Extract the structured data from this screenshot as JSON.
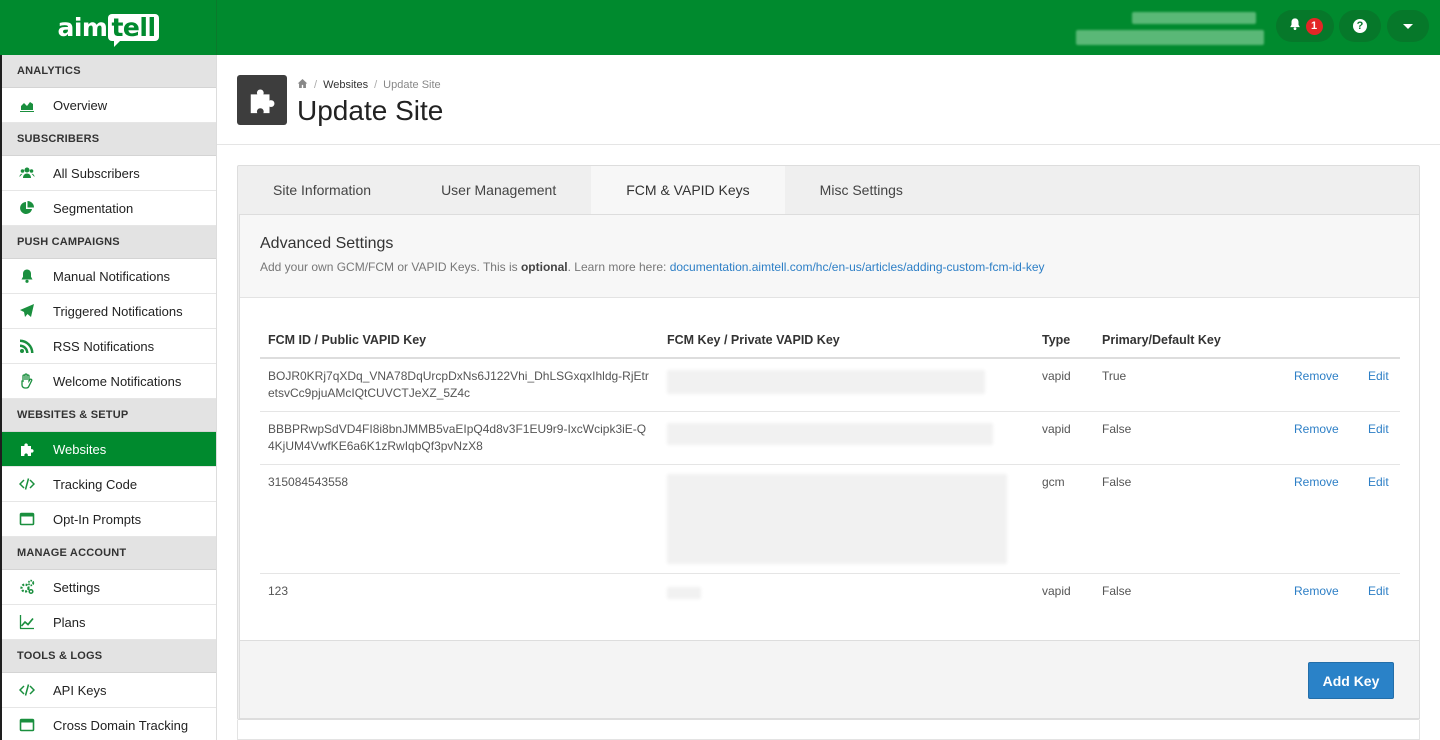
{
  "brand": {
    "logo_left": "aim",
    "logo_right": "tell",
    "accent": "#008a2e"
  },
  "topbar": {
    "notification_count": "1",
    "icons": [
      "bell-icon",
      "help-icon",
      "caret-down-icon"
    ]
  },
  "sidebar": {
    "sections": [
      {
        "title": "ANALYTICS",
        "items": [
          {
            "label": "Overview",
            "icon": "area-chart-icon"
          }
        ]
      },
      {
        "title": "SUBSCRIBERS",
        "items": [
          {
            "label": "All Subscribers",
            "icon": "users-icon"
          },
          {
            "label": "Segmentation",
            "icon": "pie-chart-icon"
          }
        ]
      },
      {
        "title": "PUSH CAMPAIGNS",
        "items": [
          {
            "label": "Manual Notifications",
            "icon": "bell-icon"
          },
          {
            "label": "Triggered Notifications",
            "icon": "paper-plane-icon"
          },
          {
            "label": "RSS Notifications",
            "icon": "rss-icon"
          },
          {
            "label": "Welcome Notifications",
            "icon": "hand-wave-icon"
          }
        ]
      },
      {
        "title": "WEBSITES & SETUP",
        "items": [
          {
            "label": "Websites",
            "icon": "puzzle-icon",
            "active": true
          },
          {
            "label": "Tracking Code",
            "icon": "code-icon"
          },
          {
            "label": "Opt-In Prompts",
            "icon": "window-icon"
          }
        ]
      },
      {
        "title": "MANAGE ACCOUNT",
        "items": [
          {
            "label": "Settings",
            "icon": "cogs-icon"
          },
          {
            "label": "Plans",
            "icon": "line-chart-icon"
          }
        ]
      },
      {
        "title": "TOOLS & LOGS",
        "items": [
          {
            "label": "API Keys",
            "icon": "code-icon"
          },
          {
            "label": "Cross Domain Tracking",
            "icon": "window-icon"
          }
        ]
      }
    ]
  },
  "header": {
    "breadcrumb": {
      "home_icon": "home-icon",
      "parent": "Websites",
      "sep": "/",
      "current": "Update Site"
    },
    "title": "Update Site",
    "page_icon": "puzzle-icon"
  },
  "tabs": [
    {
      "label": "Site Information",
      "active": false
    },
    {
      "label": "User Management",
      "active": false
    },
    {
      "label": "FCM & VAPID Keys",
      "active": true
    },
    {
      "label": "Misc Settings",
      "active": false
    }
  ],
  "advanced": {
    "title": "Advanced Settings",
    "desc_before": "Add your own GCM/FCM or VAPID Keys. This is ",
    "desc_bold": "optional",
    "desc_after": ". Learn more here: ",
    "link": "documentation.aimtell.com/hc/en-us/articles/adding-custom-fcm-id-key"
  },
  "table": {
    "headers": [
      "FCM ID / Public VAPID Key",
      "FCM Key / Private VAPID Key",
      "Type",
      "Primary/Default Key",
      "",
      ""
    ],
    "rows": [
      {
        "public_key": "BOJR0KRj7qXDq_VNA78DqUrcpDxNs6J122Vhi_DhLSGxqxIhldg-RjEtretsvCc9pjuAMcIQtCUVCTJeXZ_5Z4c",
        "type": "vapid",
        "primary": "True",
        "remove": "Remove",
        "edit": "Edit"
      },
      {
        "public_key": "BBBPRwpSdVD4FI8i8bnJMMB5vaEIpQ4d8v3F1EU9r9-IxcWcipk3iE-Q4KjUM4VwfKE6a6K1zRwIqbQf3pvNzX8",
        "type": "vapid",
        "primary": "False",
        "remove": "Remove",
        "edit": "Edit"
      },
      {
        "public_key": "315084543558",
        "type": "gcm",
        "primary": "False",
        "remove": "Remove",
        "edit": "Edit"
      },
      {
        "public_key": "123",
        "type": "vapid",
        "primary": "False",
        "remove": "Remove",
        "edit": "Edit"
      }
    ]
  },
  "footer": {
    "add_key_label": "Add Key"
  }
}
